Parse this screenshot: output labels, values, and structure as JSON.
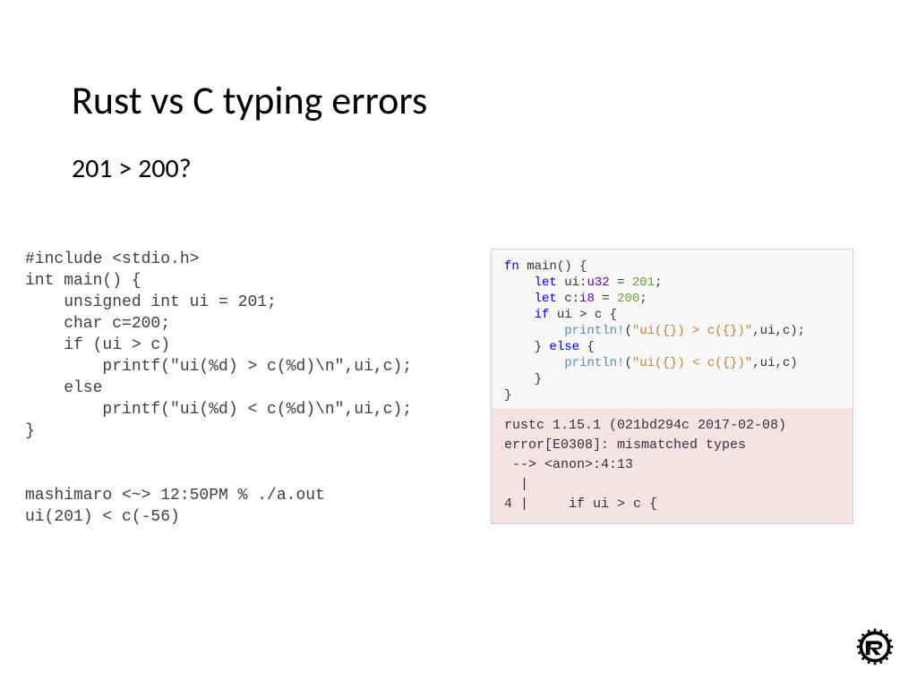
{
  "title": "Rust vs C typing errors",
  "subtitle": "201 > 200?",
  "c_code": "#include <stdio.h>\nint main() {\n    unsigned int ui = 201;\n    char c=200;\n    if (ui > c)\n        printf(\"ui(%d) > c(%d)\\n\",ui,c);\n    else\n        printf(\"ui(%d) < c(%d)\\n\",ui,c);\n}",
  "c_output": "mashimaro <~> 12:50PM % ./a.out\nui(201) < c(-56)",
  "rust_code": {
    "tokens": {
      "fn": "fn",
      "main": " main() {",
      "let1": "let",
      "ui_decl": " ui:",
      "u32": "u32",
      "eq1": " = ",
      "v201": "201",
      "semi": ";",
      "let2": "let",
      "c_decl": " c:",
      "i8": "i8",
      "eq2": " = ",
      "v200": "200",
      "if": "if",
      "cond": " ui > c {",
      "println1": "println!",
      "args1": "(",
      "args2": ",ui,c);",
      "str1": "\"ui({}) > c({})\"",
      "else": "} ",
      "else_kw": "else",
      "else_open": " {",
      "println2": "println!",
      "args3": "(",
      "args4": ",ui,c)",
      "str2": "\"ui({}) < c({})\"",
      "close1": "    }",
      "close2": "}"
    }
  },
  "rust_error": "rustc 1.15.1 (021bd294c 2017-02-08)\nerror[E0308]: mismatched types\n --> <anon>:4:13\n  |\n4 |     if ui > c {",
  "logo_name": "rust-logo"
}
